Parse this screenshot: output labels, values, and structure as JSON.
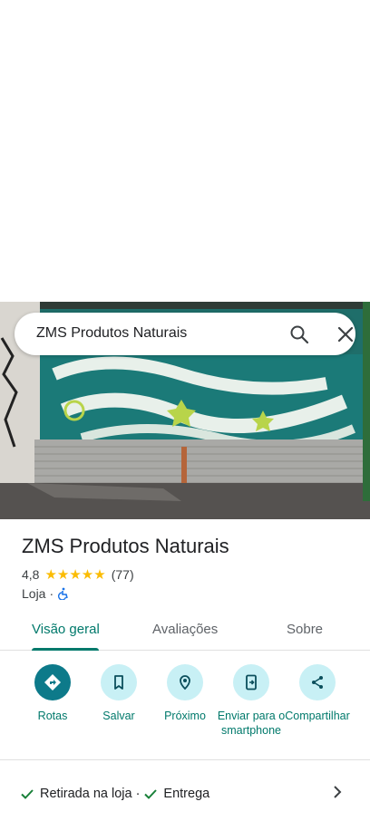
{
  "search": {
    "query": "ZMS Produtos Naturais"
  },
  "place": {
    "title": "ZMS Produtos Naturais",
    "rating": "4,8",
    "stars": "★★★★★",
    "review_count": "(77)",
    "category": "Loja",
    "separator": "·"
  },
  "tabs": [
    {
      "label": "Visão geral",
      "active": true
    },
    {
      "label": "Avaliações",
      "active": false
    },
    {
      "label": "Sobre",
      "active": false
    }
  ],
  "actions": [
    {
      "label": "Rotas",
      "icon": "directions-icon"
    },
    {
      "label": "Salvar",
      "icon": "bookmark-icon"
    },
    {
      "label": "Próximo",
      "icon": "nearby-icon"
    },
    {
      "label": "Enviar para o smartphone",
      "icon": "send-to-phone-icon"
    },
    {
      "label": "Compartilhar",
      "icon": "share-icon"
    }
  ],
  "services": {
    "item1": "Retirada na loja",
    "separator": "·",
    "item2": "Entrega"
  },
  "colors": {
    "accent": "#00796b",
    "primary_button": "#0d7a8a",
    "action_circle": "#c8f0f5",
    "star": "#fbbc04"
  }
}
